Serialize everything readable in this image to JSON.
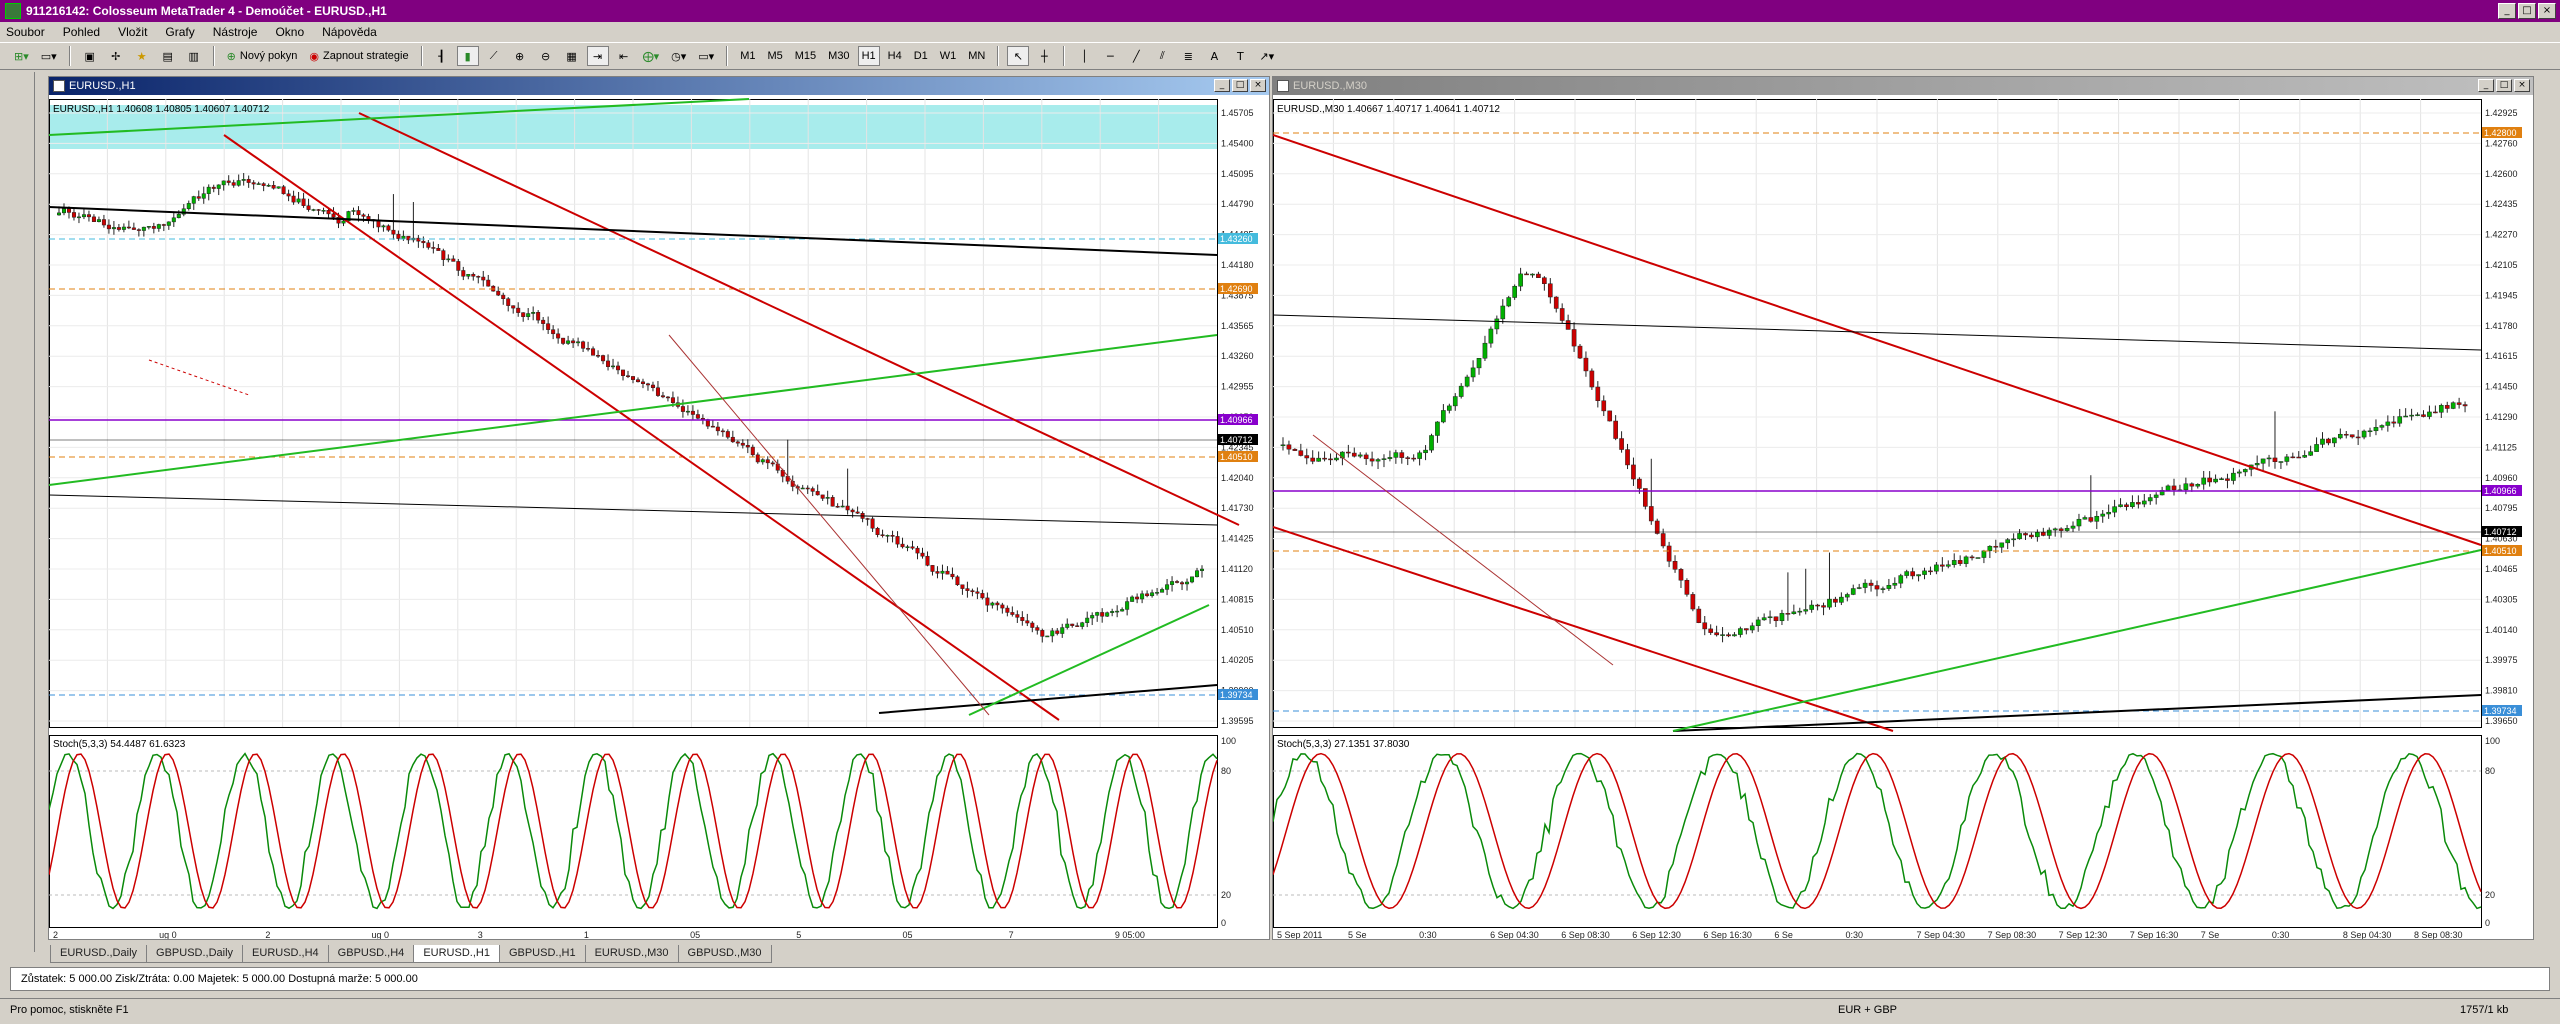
{
  "app": {
    "title": "911216142: Colosseum MetaTrader 4 - Demoúčet - EURUSD.,H1"
  },
  "menu": [
    "Soubor",
    "Pohled",
    "Vložit",
    "Grafy",
    "Nástroje",
    "Okno",
    "Nápověda"
  ],
  "toolbar": {
    "new_order": "Nový pokyn",
    "strategies": "Zapnout strategie",
    "timeframes": [
      "M1",
      "M5",
      "M15",
      "M30",
      "H1",
      "H4",
      "D1",
      "W1",
      "MN"
    ],
    "active_timeframe": "H1"
  },
  "left_chart": {
    "title": "EURUSD.,H1",
    "info": "EURUSD.,H1  1.40608 1.40805 1.40607 1.40712",
    "osc_label": "Stoch(5,3,3) 54.4487 61.6323",
    "price_labels": [
      "1.45705",
      "1.45400",
      "1.45095",
      "1.44790",
      "1.44485",
      "1.44180",
      "1.43875",
      "1.43565",
      "1.43260",
      "1.42955",
      "1.42650",
      "1.42345",
      "1.42040",
      "1.41730",
      "1.41425",
      "1.41120",
      "1.40815",
      "1.40510",
      "1.40205",
      "1.39900",
      "1.39595"
    ],
    "hl_labels": {
      "purple": "1.40966",
      "current": "1.40712",
      "orange": "1.40510",
      "blue": "1.39734",
      "cyan": "1.43260",
      "orange2": "1.42690"
    },
    "osc_levels": [
      "100",
      "80",
      "20",
      "0"
    ],
    "time_labels": [
      "2",
      "ug 0",
      "2",
      "ug 0",
      "3",
      "1",
      "05",
      "5",
      "05",
      "7",
      "9 05:00"
    ]
  },
  "right_chart": {
    "title": "EURUSD.,M30",
    "info": "EURUSD.,M30  1.40667 1.40717 1.40641 1.40712",
    "osc_label": "Stoch(5,3,3) 27.1351 37.8030",
    "price_labels": [
      "1.42925",
      "1.42760",
      "1.42600",
      "1.42435",
      "1.42270",
      "1.42105",
      "1.41945",
      "1.41780",
      "1.41615",
      "1.41450",
      "1.41290",
      "1.41125",
      "1.40960",
      "1.40795",
      "1.40630",
      "1.40465",
      "1.40305",
      "1.40140",
      "1.39975",
      "1.39810",
      "1.39650"
    ],
    "hl_labels": {
      "purple": "1.40966",
      "current": "1.40712",
      "orange": "1.40510",
      "blue": "1.39734",
      "orange_top": "1.42800"
    },
    "osc_levels": [
      "100",
      "80",
      "20",
      "0"
    ],
    "time_labels": [
      "5 Sep 2011",
      "5 Se",
      "0:30",
      "6 Sep 04:30",
      "6 Sep 08:30",
      "6 Sep 12:30",
      "6 Sep 16:30",
      "6 Se",
      "0:30",
      "7 Sep 04:30",
      "7 Sep 08:30",
      "7 Sep 12:30",
      "7 Sep 16:30",
      "7 Se",
      "0:30",
      "8 Sep 04:30",
      "8 Sep 08:30"
    ]
  },
  "tabs": [
    "EURUSD.,Daily",
    "GBPUSD.,Daily",
    "EURUSD.,H4",
    "GBPUSD.,H4",
    "EURUSD.,H1",
    "GBPUSD.,H1",
    "EURUSD.,M30",
    "GBPUSD.,M30"
  ],
  "active_tab": "EURUSD.,H1",
  "terminal": {
    "text": "Zůstatek: 5 000.00  Zisk/Ztráta: 0.00  Majetek: 5 000.00  Dostupná marže: 5 000.00"
  },
  "status": {
    "help": "Pro pomoc, stiskněte F1",
    "profile": "EUR + GBP",
    "traffic": "1757/1 kb"
  },
  "colors": {
    "title_bar": "#800080",
    "bull": "#00b000",
    "bear": "#cc0000",
    "trend_red": "#cc0000",
    "trend_green": "#22bb22",
    "purple_line": "#8800cc",
    "orange_dash": "#e08010",
    "cyan_band": "#a8ecec"
  }
}
